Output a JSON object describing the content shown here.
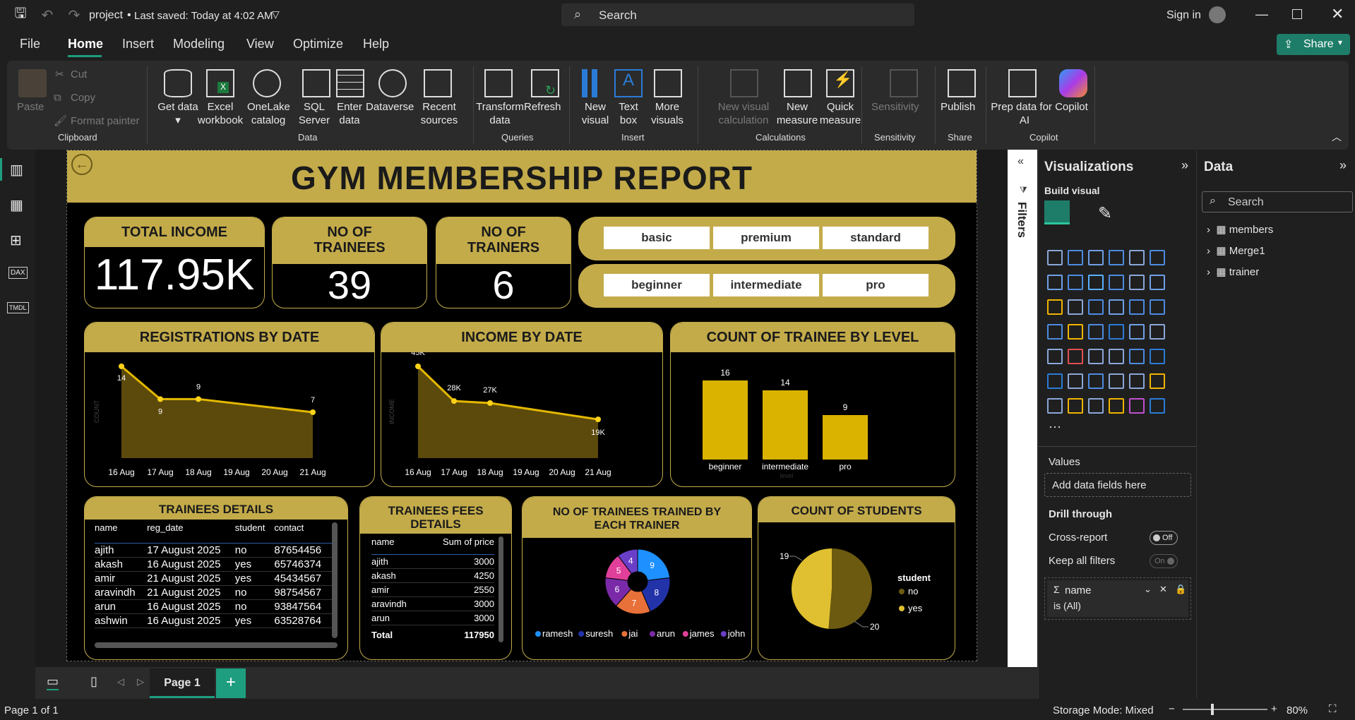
{
  "app": {
    "title": "project",
    "saved": "Last saved: Today at 4:02 AM",
    "search": "Search",
    "signin": "Sign in",
    "share": "Share"
  },
  "menu": [
    "File",
    "Home",
    "Insert",
    "Modeling",
    "View",
    "Optimize",
    "Help"
  ],
  "ribbon": {
    "paste": "Paste",
    "cut": "Cut",
    "copy": "Copy",
    "format_painter": "Format painter",
    "clipboard": "Clipboard",
    "get_data": "Get data",
    "excel": "Excel workbook",
    "onelake": "OneLake catalog",
    "sql": "SQL Server",
    "enter": "Enter data",
    "dataverse": "Dataverse",
    "recent": "Recent sources",
    "data": "Data",
    "transform": "Transform data",
    "refresh": "Refresh",
    "queries": "Queries",
    "new_visual": "New visual",
    "text_box": "Text box",
    "more_visuals": "More visuals",
    "insert": "Insert",
    "new_visual_calc": "New visual calculation",
    "new_measure": "New measure",
    "quick_measure": "Quick measure",
    "calculations": "Calculations",
    "sensitivity": "Sensitivity",
    "sensitivity_grp": "Sensitivity",
    "publish": "Publish",
    "share_grp": "Share",
    "prep": "Prep data for Copilot AI",
    "prep_l1": "Prep data for Copilot",
    "prep_l2": "AI",
    "copilot": "Copilot"
  },
  "report": {
    "title": "GYM MEMBERSHIP REPORT",
    "kpi": [
      {
        "label": "TOTAL INCOME",
        "value": "117.95K"
      },
      {
        "label1": "NO OF",
        "label2": "TRAINEES",
        "value": "39"
      },
      {
        "label1": "NO OF",
        "label2": "TRAINERS",
        "value": "6"
      }
    ],
    "plans": [
      "basic",
      "premium",
      "standard"
    ],
    "levels": [
      "beginner",
      "intermediate",
      "pro"
    ],
    "reg_title": "REGISTRATIONS BY DATE",
    "income_title": "INCOME BY DATE",
    "level_title": "COUNT OF TRAINEE BY LEVEL",
    "details_title": "TRAINEES DETAILS",
    "fees_title": "TRAINEES FEES DETAILS",
    "trainer_title": "NO OF TRAINEES TRAINED BY EACH TRAINER",
    "students_title": "COUNT OF STUDENTS",
    "details": {
      "headers": [
        "name",
        "reg_date",
        "student",
        "contact"
      ],
      "rows": [
        [
          "ajith",
          "17 August 2025",
          "no",
          "87654456"
        ],
        [
          "akash",
          "16 August 2025",
          "yes",
          "65746374"
        ],
        [
          "amir",
          "21 August 2025",
          "yes",
          "45434567"
        ],
        [
          "aravindh",
          "21 August 2025",
          "no",
          "98754567"
        ],
        [
          "arun",
          "16 August 2025",
          "no",
          "93847564"
        ],
        [
          "ashwin",
          "16 August 2025",
          "yes",
          "63528764"
        ]
      ]
    },
    "fees": {
      "headers": [
        "name",
        "Sum of price"
      ],
      "rows": [
        [
          "ajith",
          "3000"
        ],
        [
          "akash",
          "4250"
        ],
        [
          "amir",
          "2550"
        ],
        [
          "aravindh",
          "3000"
        ],
        [
          "arun",
          "3000"
        ]
      ],
      "total_label": "Total",
      "total": "117950"
    }
  },
  "chart_data": [
    {
      "type": "area",
      "title": "REGISTRATIONS BY DATE",
      "ylabel": "COUNT",
      "x": [
        "16 Aug",
        "17 Aug",
        "18 Aug",
        "19 Aug",
        "20 Aug",
        "21 Aug"
      ],
      "series": [
        {
          "values": [
            14,
            9,
            9,
            null,
            null,
            7
          ]
        }
      ],
      "labels": [
        "14",
        "9",
        "9",
        "7"
      ]
    },
    {
      "type": "area",
      "title": "INCOME BY DATE",
      "ylabel": "INCOME",
      "x": [
        "16 Aug",
        "17 Aug",
        "18 Aug",
        "19 Aug",
        "20 Aug",
        "21 Aug"
      ],
      "series": [
        {
          "values": [
            45000,
            28000,
            27000,
            null,
            null,
            19000
          ]
        }
      ],
      "labels": [
        "45K",
        "28K",
        "27K",
        "19K"
      ]
    },
    {
      "type": "bar",
      "title": "COUNT OF TRAINEE BY LEVEL",
      "xlabel": "level",
      "categories": [
        "beginner",
        "intermediate",
        "pro"
      ],
      "values": [
        16,
        14,
        9
      ],
      "color": "#d9b300"
    },
    {
      "type": "pie",
      "title": "NO OF TRAINEES TRAINED BY EACH TRAINER",
      "donut": true,
      "slices": [
        {
          "label": "9",
          "value": 9,
          "color": "#1e90ff"
        },
        {
          "label": "8",
          "value": 8,
          "color": "#2233aa"
        },
        {
          "label": "7",
          "value": 7,
          "color": "#e8713a"
        },
        {
          "label": "6",
          "value": 6,
          "color": "#7a2aa8"
        },
        {
          "label": "5",
          "value": 5,
          "color": "#e0409a"
        },
        {
          "label": "4",
          "value": 4,
          "color": "#6a3fc8"
        }
      ],
      "legend": [
        {
          "name": "ramesh",
          "color": "#1e90ff"
        },
        {
          "name": "suresh",
          "color": "#2233aa"
        },
        {
          "name": "jai",
          "color": "#e8713a"
        },
        {
          "name": "arun",
          "color": "#7a2aa8"
        },
        {
          "name": "james",
          "color": "#e0409a"
        },
        {
          "name": "john",
          "color": "#6a3fc8"
        }
      ]
    },
    {
      "type": "pie",
      "title": "COUNT OF STUDENTS",
      "legend_title": "student",
      "slices": [
        {
          "name": "no",
          "value": 20,
          "label": "20",
          "color": "#6b5a10"
        },
        {
          "name": "yes",
          "value": 19,
          "label": "19",
          "color": "#e0c030"
        }
      ]
    }
  ],
  "viz": {
    "title": "Visualizations",
    "build": "Build visual",
    "values": "Values",
    "add": "Add data fields here",
    "drill": "Drill through",
    "cross": "Cross-report",
    "cross_state": "Off",
    "keep": "Keep all filters",
    "keep_state": "On",
    "filter_field": "name",
    "filter_val": "is (All)"
  },
  "data": {
    "title": "Data",
    "search": "Search",
    "tables": [
      "members",
      "Merge1",
      "trainer"
    ]
  },
  "filters_label": "Filters",
  "page": {
    "tab": "Page 1",
    "status": "Page 1 of 1",
    "storage": "Storage Mode: Mixed",
    "zoom": "80%"
  },
  "colors": {
    "gold": "#c3ab4a",
    "accent": "#1e9e7e"
  }
}
